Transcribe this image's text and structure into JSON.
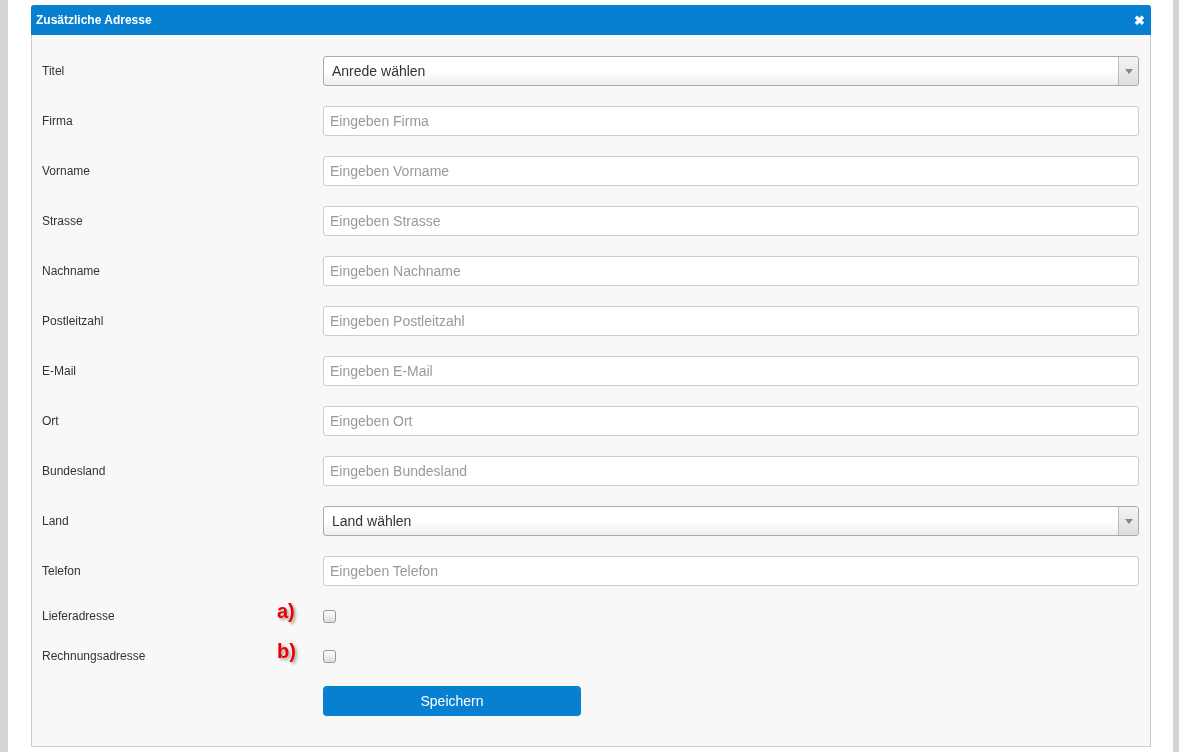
{
  "dialog": {
    "title": "Zusätzliche Adresse",
    "close": "✖"
  },
  "fields": [
    {
      "label": "Titel",
      "kind": "select",
      "value": "Anrede wählen"
    },
    {
      "label": "Firma",
      "kind": "text",
      "placeholder": "Eingeben Firma"
    },
    {
      "label": "Vorname",
      "kind": "text",
      "placeholder": "Eingeben Vorname"
    },
    {
      "label": "Strasse",
      "kind": "text",
      "placeholder": "Eingeben Strasse"
    },
    {
      "label": "Nachname",
      "kind": "text",
      "placeholder": "Eingeben Nachname"
    },
    {
      "label": "Postleitzahl",
      "kind": "text",
      "placeholder": "Eingeben Postleitzahl"
    },
    {
      "label": "E-Mail",
      "kind": "text",
      "placeholder": "Eingeben E-Mail"
    },
    {
      "label": "Ort",
      "kind": "text",
      "placeholder": "Eingeben Ort"
    },
    {
      "label": "Bundesland",
      "kind": "text",
      "placeholder": "Eingeben Bundesland"
    },
    {
      "label": "Land",
      "kind": "select",
      "value": "Land wählen"
    },
    {
      "label": "Telefon",
      "kind": "text",
      "placeholder": "Eingeben Telefon"
    },
    {
      "label": "Lieferadresse",
      "kind": "checkbox",
      "checked": false,
      "marker": "a)"
    },
    {
      "label": "Rechnungsadresse",
      "kind": "checkbox",
      "checked": false,
      "marker": "b)"
    }
  ],
  "save_button": "Speichern"
}
